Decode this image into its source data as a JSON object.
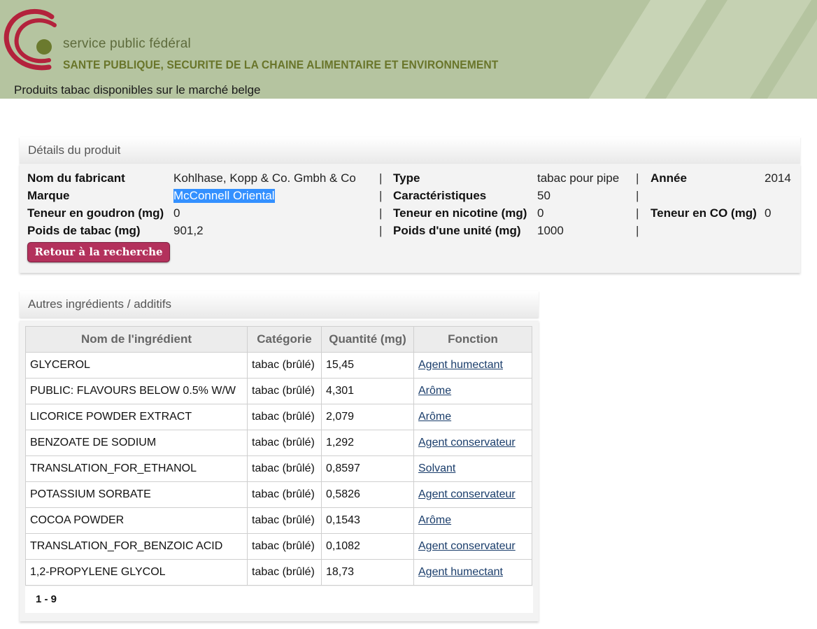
{
  "header": {
    "org_line1": "service public fédéral",
    "org_line2": "SANTE PUBLIQUE, SECURITE DE LA CHAINE ALIMENTAIRE  ET ENVIRONNEMENT",
    "site_title": "Produits tabac disponibles sur le marché belge",
    "colors": {
      "banner": "#b5c4a0",
      "logo_red": "#b3223c",
      "logo_dot": "#6b7a2e"
    }
  },
  "details": {
    "title": "Détails du produit",
    "fabricant_label": "Nom du fabricant",
    "fabricant_value": "Kohlhase, Kopp & Co. Gmbh & Co",
    "type_label": "Type",
    "type_value": "tabac pour pipe",
    "annee_label": "Année",
    "annee_value": "2014",
    "marque_label": "Marque",
    "marque_value": "McConnell Oriental",
    "caract_label": "Caractéristiques",
    "caract_value": "50",
    "goudron_label": "Teneur en goudron (mg)",
    "goudron_value": "0",
    "nicotine_label": "Teneur en nicotine (mg)",
    "nicotine_value": "0",
    "co_label": "Teneur en CO (mg)",
    "co_value": "0",
    "poids_tabac_label": "Poids de tabac (mg)",
    "poids_tabac_value": "901,2",
    "poids_unite_label": "Poids d'une unité (mg)",
    "poids_unite_value": "1000",
    "separator": "|",
    "back_button": "Retour à la recherche"
  },
  "ingredients": {
    "title": "Autres ingrédients / additifs",
    "columns": [
      "Nom de l'ingrédient",
      "Catégorie",
      "Quantité (mg)",
      "Fonction"
    ],
    "rows": [
      {
        "name": "GLYCEROL",
        "category": "tabac (brûlé)",
        "quantity": "15,45",
        "function": "Agent humectant"
      },
      {
        "name": "PUBLIC: FLAVOURS BELOW 0.5% W/W",
        "category": "tabac (brûlé)",
        "quantity": "4,301",
        "function": "Arôme"
      },
      {
        "name": "LICORICE POWDER EXTRACT",
        "category": "tabac (brûlé)",
        "quantity": "2,079",
        "function": "Arôme"
      },
      {
        "name": "BENZOATE DE SODIUM",
        "category": "tabac (brûlé)",
        "quantity": "1,292",
        "function": "Agent conservateur"
      },
      {
        "name": "TRANSLATION_FOR_ETHANOL",
        "category": "tabac (brûlé)",
        "quantity": "0,8597",
        "function": "Solvant"
      },
      {
        "name": "POTASSIUM SORBATE",
        "category": "tabac (brûlé)",
        "quantity": "0,5826",
        "function": "Agent conservateur"
      },
      {
        "name": "COCOA POWDER",
        "category": "tabac (brûlé)",
        "quantity": "0,1543",
        "function": "Arôme"
      },
      {
        "name": "TRANSLATION_FOR_BENZOIC ACID",
        "category": "tabac (brûlé)",
        "quantity": "0,1082",
        "function": "Agent conservateur"
      },
      {
        "name": "1,2-PROPYLENE GLYCOL",
        "category": "tabac (brûlé)",
        "quantity": "18,73",
        "function": "Agent humectant"
      }
    ],
    "pager": "1 - 9"
  }
}
